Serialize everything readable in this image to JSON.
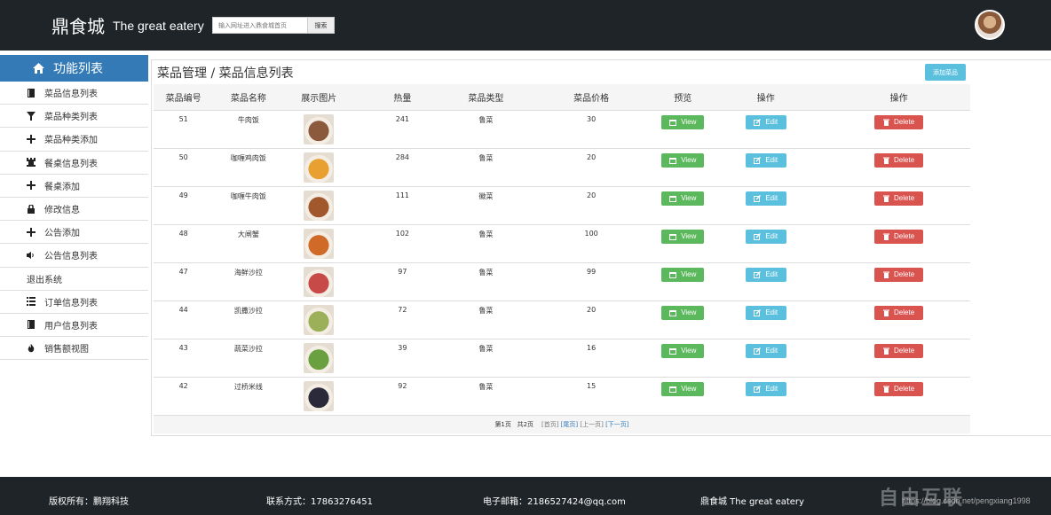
{
  "header": {
    "brand_cn": "鼎食城",
    "brand_en": "The great eatery",
    "search_placeholder": "输入网址进入鼎食城首页",
    "search_button": "搜索"
  },
  "sidebar": {
    "title": "功能列表",
    "items": [
      {
        "label": "菜品信息列表",
        "icon": "book-icon"
      },
      {
        "label": "菜品种类列表",
        "icon": "filter-icon"
      },
      {
        "label": "菜品种类添加",
        "icon": "plus-icon"
      },
      {
        "label": "餐桌信息列表",
        "icon": "tower-icon"
      },
      {
        "label": "餐桌添加",
        "icon": "plus-icon"
      },
      {
        "label": "修改信息",
        "icon": "lock-icon"
      },
      {
        "label": "公告添加",
        "icon": "plus-icon"
      },
      {
        "label": "公告信息列表",
        "icon": "volume-icon"
      },
      {
        "label": "退出系统",
        "icon": ""
      },
      {
        "label": "订单信息列表",
        "icon": "list-icon"
      },
      {
        "label": "用户信息列表",
        "icon": "book-icon"
      },
      {
        "label": "销售额视图",
        "icon": "fire-icon"
      }
    ]
  },
  "panel": {
    "breadcrumb": "菜品管理 / 菜品信息列表",
    "add_button": "添加菜品"
  },
  "table": {
    "headers": [
      "菜品编号",
      "菜品名称",
      "展示图片",
      "热量",
      "菜品类型",
      "菜品价格",
      "预览",
      "操作",
      "操作"
    ],
    "view_label": "View",
    "edit_label": "Edit",
    "delete_label": "Delete",
    "rows": [
      {
        "id": "51",
        "name": "牛肉饭",
        "calories": "241",
        "type": "鲁菜",
        "price": "30",
        "thumb_color": "#8b5a3c"
      },
      {
        "id": "50",
        "name": "咖喱鸡肉饭",
        "calories": "284",
        "type": "鲁菜",
        "price": "20",
        "thumb_color": "#e8a030"
      },
      {
        "id": "49",
        "name": "咖喱牛肉饭",
        "calories": "111",
        "type": "徽菜",
        "price": "20",
        "thumb_color": "#a0582c"
      },
      {
        "id": "48",
        "name": "大闸蟹",
        "calories": "102",
        "type": "鲁菜",
        "price": "100",
        "thumb_color": "#d06a28"
      },
      {
        "id": "47",
        "name": "海鲜沙拉",
        "calories": "97",
        "type": "鲁菜",
        "price": "99",
        "thumb_color": "#c84a48"
      },
      {
        "id": "44",
        "name": "凯撒沙拉",
        "calories": "72",
        "type": "鲁菜",
        "price": "20",
        "thumb_color": "#9cb05a"
      },
      {
        "id": "43",
        "name": "蔬菜沙拉",
        "calories": "39",
        "type": "鲁菜",
        "price": "16",
        "thumb_color": "#6aa040"
      },
      {
        "id": "42",
        "name": "过桥米线",
        "calories": "92",
        "type": "鲁菜",
        "price": "15",
        "thumb_color": "#2a2a3a"
      }
    ]
  },
  "pager": {
    "current": "第1页",
    "total": "共2页",
    "first": "[首页]",
    "last": "[尾页]",
    "prev": "[上一页]",
    "next": "[下一页]"
  },
  "footer": {
    "copyright": "版权所有：鹏翔科技",
    "contact": "联系方式：17863276451",
    "email": "电子邮箱：2186527424@qq.com",
    "brand": "鼎食城 The great eatery",
    "watermark_url": "https://blog.csdn.net/pengxiang1998",
    "watermark_logo": "自由互联"
  }
}
